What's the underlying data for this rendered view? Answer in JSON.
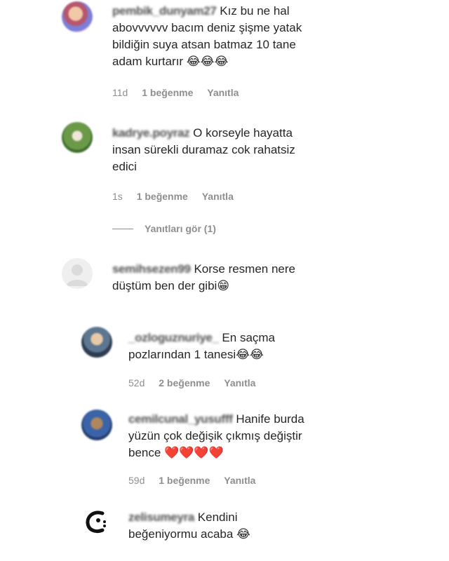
{
  "comments": [
    {
      "username": "pembik_dunyam27",
      "text": "Kız bu ne hal abovvvvvv bacım deniz şişme yatak bildiğin suya atsan batmaz 10 tane adam kurtarır 😂😂😂",
      "time": "11d",
      "likes": "1 beğenme",
      "reply": "Yanıtla"
    },
    {
      "username": "kadrye.poyraz",
      "text": "O korseyle hayatta insan sürekli duramaz cok rahatsiz edici",
      "time": "1s",
      "likes": "1 beğenme",
      "reply": "Yanıtla",
      "view_replies": "Yanıtları gör (1)"
    },
    {
      "username": "semihsezen99",
      "text": "Korse resmen nere düştüm ben der gibi😁"
    },
    {
      "username": "_ozloguznuriye_",
      "text": "En saçma pozlarından 1 tanesi😂😂",
      "time": "52d",
      "likes": "2 beğenme",
      "reply": "Yanıtla"
    },
    {
      "username": "cemilcunal_yusufff",
      "text": "Hanife burda yüzün çok değişik çıkmış değiştir bence ❤️❤️❤️❤️",
      "time": "59d",
      "likes": "1 beğenme",
      "reply": "Yanıtla"
    },
    {
      "username": "zelisumeyra",
      "text": "Kendini beğeniyormu acaba 😂"
    }
  ],
  "colors": {
    "text": "#262626",
    "secondary": "#8e8e8e",
    "background": "#ffffff"
  }
}
